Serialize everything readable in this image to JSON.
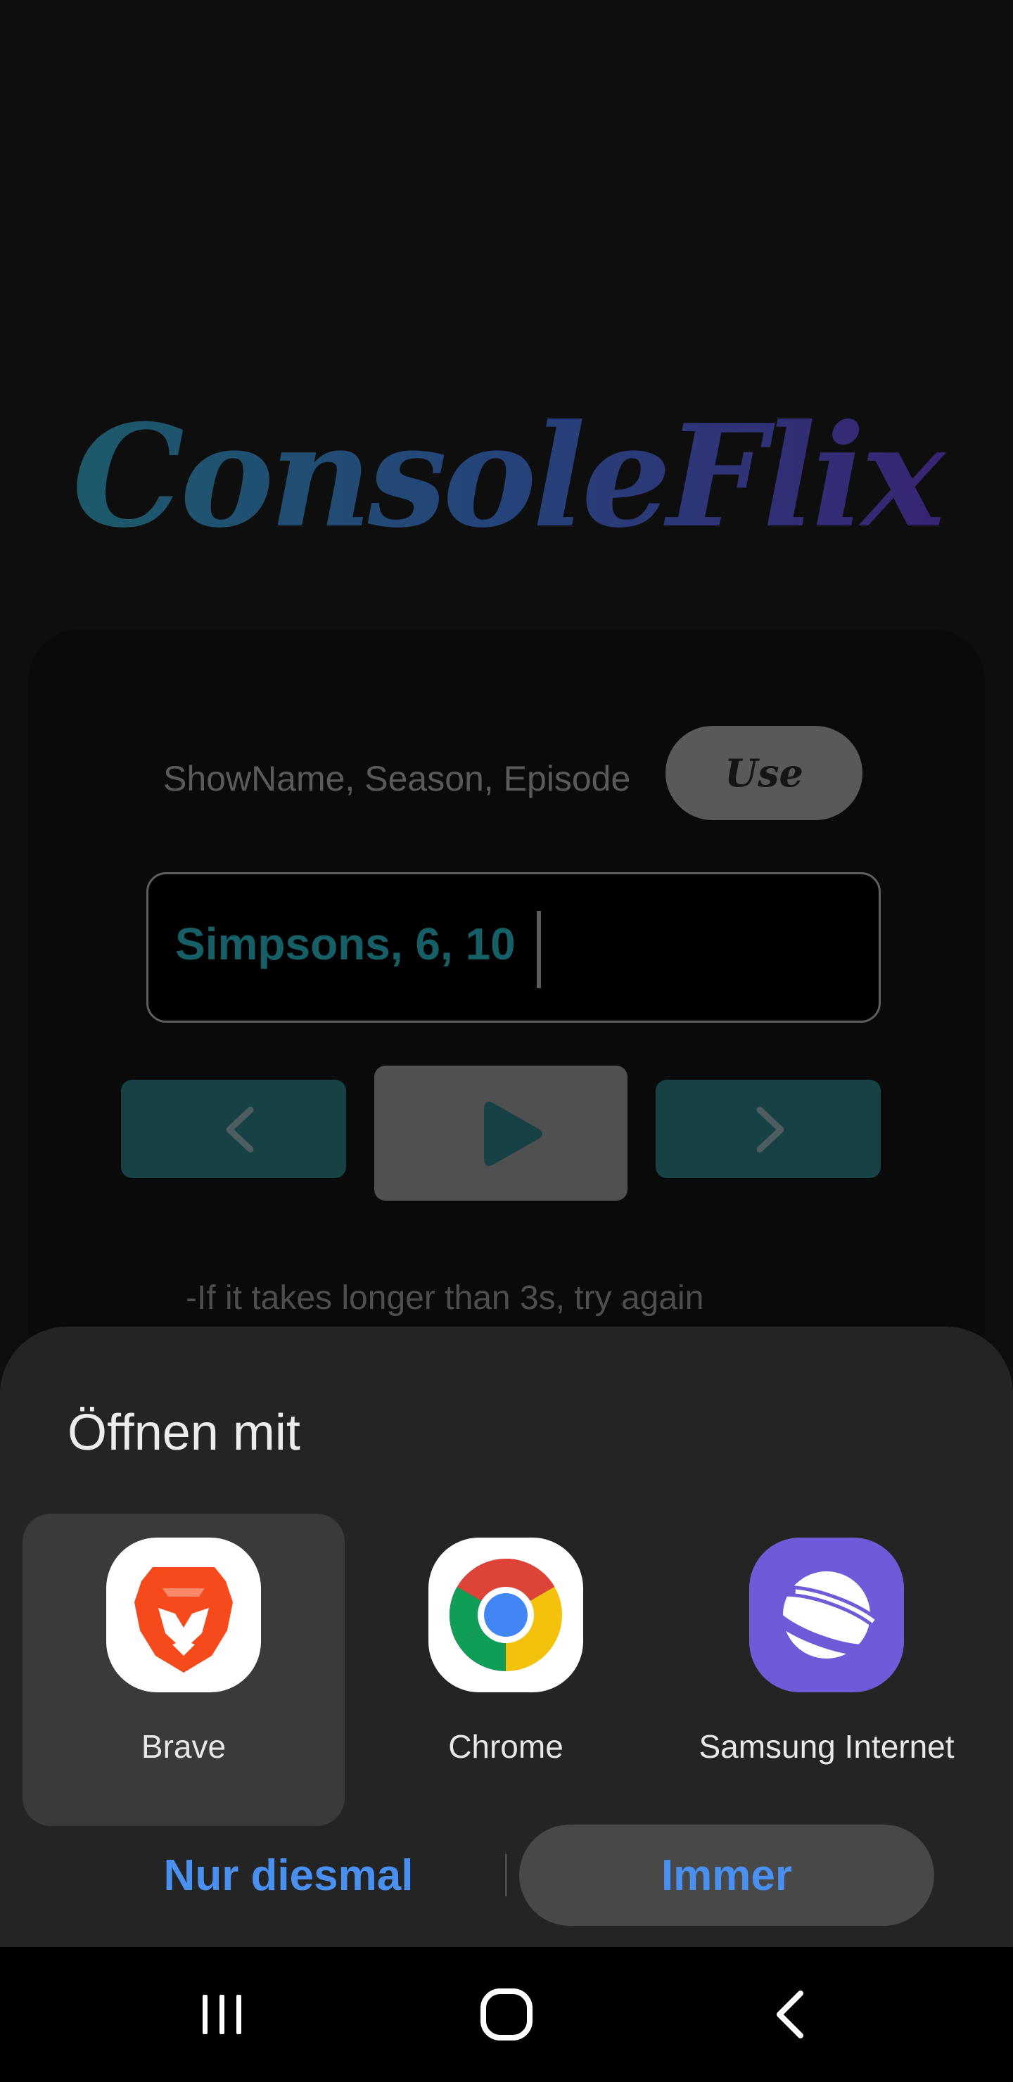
{
  "app": {
    "logo": "ConsoleFlix",
    "format_label": "ShowName, Season, Episode",
    "use_button": "Use",
    "episode_input_value": "Simpsons, 6, 10",
    "hint": "-If it takes longer than 3s, try again",
    "accent": "#175f66"
  },
  "dialog": {
    "title": "Öffnen mit",
    "apps": [
      {
        "label": "Brave",
        "icon": "brave-lion-icon",
        "selected": true
      },
      {
        "label": "Chrome",
        "icon": "chrome-icon",
        "selected": false
      },
      {
        "label": "Samsung Internet",
        "icon": "samsung-internet-planet-icon",
        "selected": false
      }
    ],
    "once_label": "Nur diesmal",
    "always_label": "Immer",
    "action_color": "#4a90f0"
  },
  "navbar": {
    "recent": "recent-apps-icon",
    "home": "home-icon",
    "back": "back-icon"
  }
}
